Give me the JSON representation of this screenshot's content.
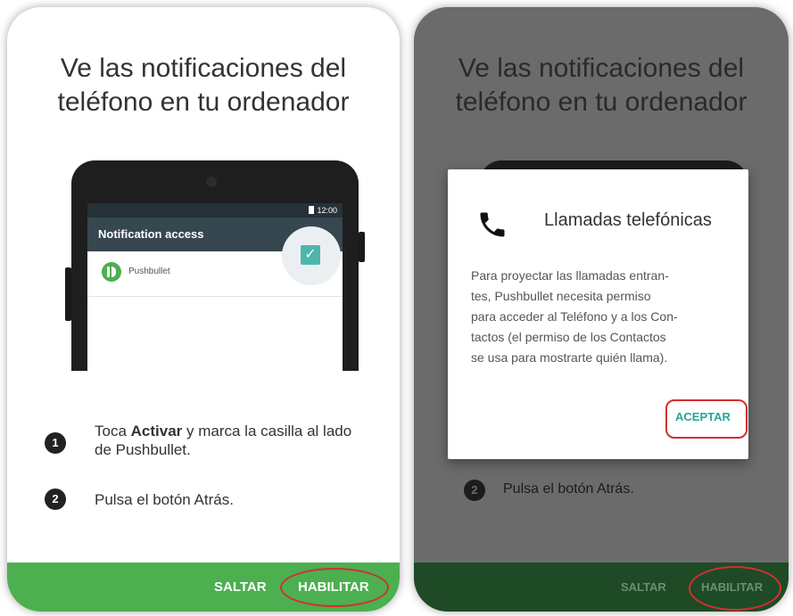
{
  "left_screen": {
    "title_line1": "Ve las notificaciones del",
    "title_line2": "teléfono en tu ordenador",
    "phone": {
      "status_time": "12:00",
      "appbar_title": "Notification access",
      "app_name": "Pushbullet",
      "checkbox_mark": "✓"
    },
    "steps": [
      {
        "number": "1",
        "text_before": "Toca ",
        "text_bold": "Activar",
        "text_after": " y marca la casilla al lado de Pushbullet."
      },
      {
        "number": "2",
        "text": "Pulsa el botón Atrás."
      }
    ],
    "bottom_bar": {
      "skip_label": "SALTAR",
      "enable_label": "HABILITAR"
    }
  },
  "right_screen": {
    "title_line1": "Ve las notificaciones del",
    "title_line2": "teléfono en tu ordenador",
    "dialog": {
      "icon": "phone-icon",
      "title": "Llamadas telefónicas",
      "body_lines": [
        "Para proyectar las llamadas entran-",
        "tes, Pushbullet necesita permiso",
        "para acceder al Teléfono y a los Con-",
        "tactos (el permiso de los Contactos",
        "se usa para mostrarte quién llama)."
      ],
      "accept_label": "ACEPTAR"
    },
    "step2": {
      "number": "2",
      "text": "Pulsa el botón Atrás."
    },
    "bottom_bar": {
      "skip_label": "SALTAR",
      "enable_label": "HABILITAR"
    }
  },
  "colors": {
    "accent_green": "#4caf50",
    "dark_green": "#1f4a26",
    "teal": "#26a69a",
    "highlight_red": "#d32f2f"
  }
}
